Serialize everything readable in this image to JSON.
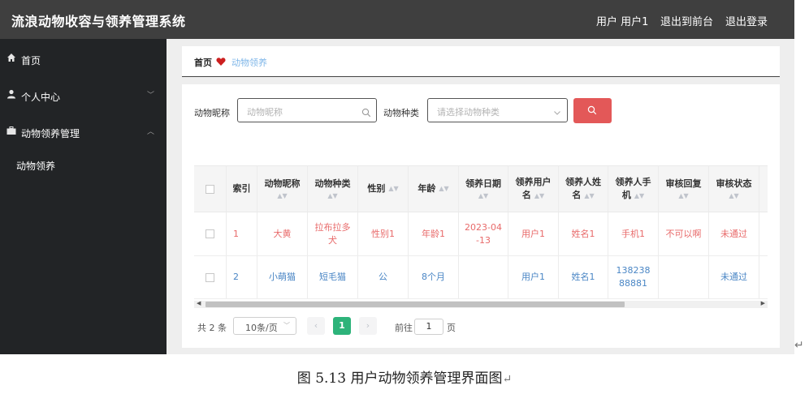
{
  "header": {
    "title": "流浪动物收容与领养管理系统",
    "user_label": "用户 用户1",
    "front_label": "退出到前台",
    "logout_label": "退出登录"
  },
  "sidebar": {
    "items": [
      {
        "label": "首页",
        "icon": "home-icon"
      },
      {
        "label": "个人中心",
        "icon": "user-icon"
      },
      {
        "label": "动物领养管理",
        "icon": "briefcase-icon"
      }
    ],
    "sub_item": "动物领养"
  },
  "breadcrumb": {
    "home": "首页",
    "current": "动物领养"
  },
  "filters": {
    "name_label": "动物昵称",
    "name_placeholder": "动物昵称",
    "type_label": "动物种类",
    "type_placeholder": "请选择动物种类"
  },
  "table": {
    "headers": [
      {
        "lines": [
          "索引"
        ]
      },
      {
        "lines": [
          "动物昵称"
        ]
      },
      {
        "lines": [
          "动物种类"
        ]
      },
      {
        "lines": [
          "性别"
        ]
      },
      {
        "lines": [
          "年龄"
        ]
      },
      {
        "lines": [
          "领养日期"
        ]
      },
      {
        "lines": [
          "领养用户",
          "名"
        ]
      },
      {
        "lines": [
          "领养人姓",
          "名"
        ]
      },
      {
        "lines": [
          "领养人手",
          "机"
        ]
      },
      {
        "lines": [
          "审核回复"
        ]
      },
      {
        "lines": [
          "审核状态"
        ]
      }
    ],
    "rows": [
      {
        "index": "1",
        "name": "大黄",
        "type": "拉布拉多犬",
        "gender": "性别1",
        "age": "年龄1",
        "date": "2023-04-13",
        "user": "用户1",
        "real_name": "姓名1",
        "phone": "手机1",
        "reply": "不可以啊",
        "status": "未通过"
      },
      {
        "index": "2",
        "name": "小萌猫",
        "type": "短毛猫",
        "gender": "公",
        "age": "8个月",
        "date": "",
        "user": "用户1",
        "real_name": "姓名1",
        "phone": "13823888881",
        "reply": "",
        "status": "未通过"
      }
    ]
  },
  "pagination": {
    "total": "共 2 条",
    "page_size": "10条/页",
    "current_page": "1",
    "goto_label": "前往",
    "goto_value": "1",
    "page_unit": "页"
  },
  "caption": "图 5.13 用户动物领养管理界面图",
  "colors": {
    "header_bg": "#3f3f3f",
    "sidebar_bg": "#222426",
    "search_button": "#e35858",
    "active_page": "#2db37a",
    "row1_text": "#e86a6a",
    "row2_text": "#4a86c5",
    "breadcrumb_heart": "#cc1f1f"
  }
}
